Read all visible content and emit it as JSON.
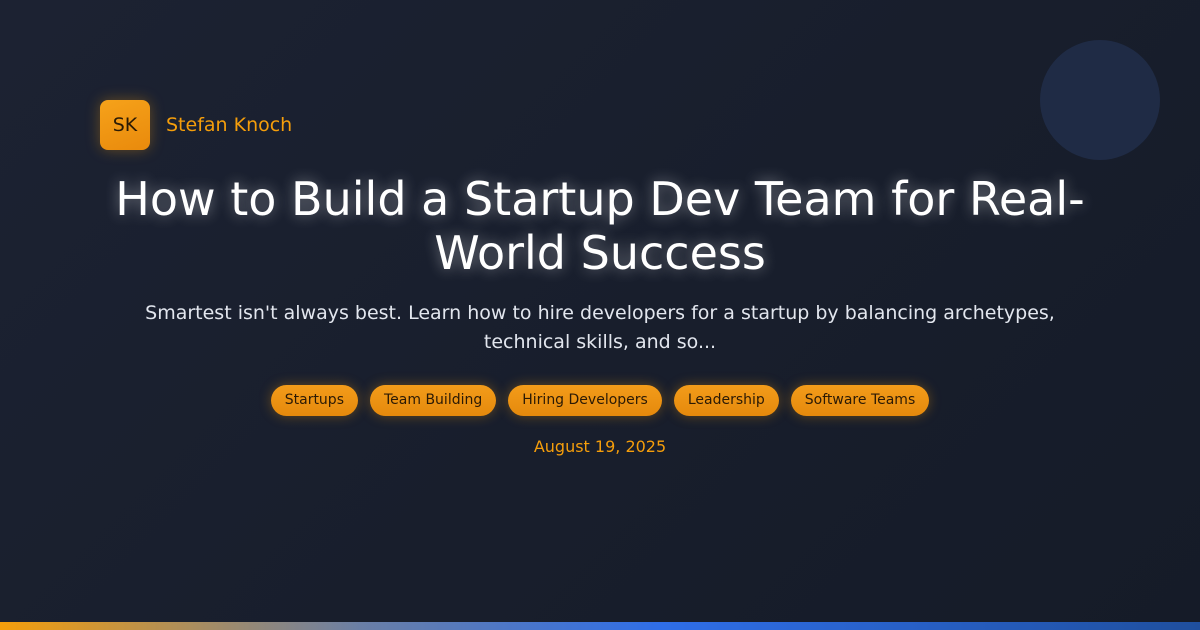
{
  "author": {
    "initials": "SK",
    "name": "Stefan Knoch"
  },
  "post": {
    "title": "How to Build a Startup Dev Team for Real-World Success",
    "subtitle": "Smartest isn't always best. Learn how to hire developers for a startup by balancing archetypes, technical skills, and so...",
    "tags": [
      "Startups",
      "Team Building",
      "Hiring Developers",
      "Leadership",
      "Software Teams"
    ],
    "date": "August 19, 2025"
  },
  "colors": {
    "accent": "#f59e0b",
    "background": "#1a2030",
    "bar_blue": "#2f6ee8"
  }
}
